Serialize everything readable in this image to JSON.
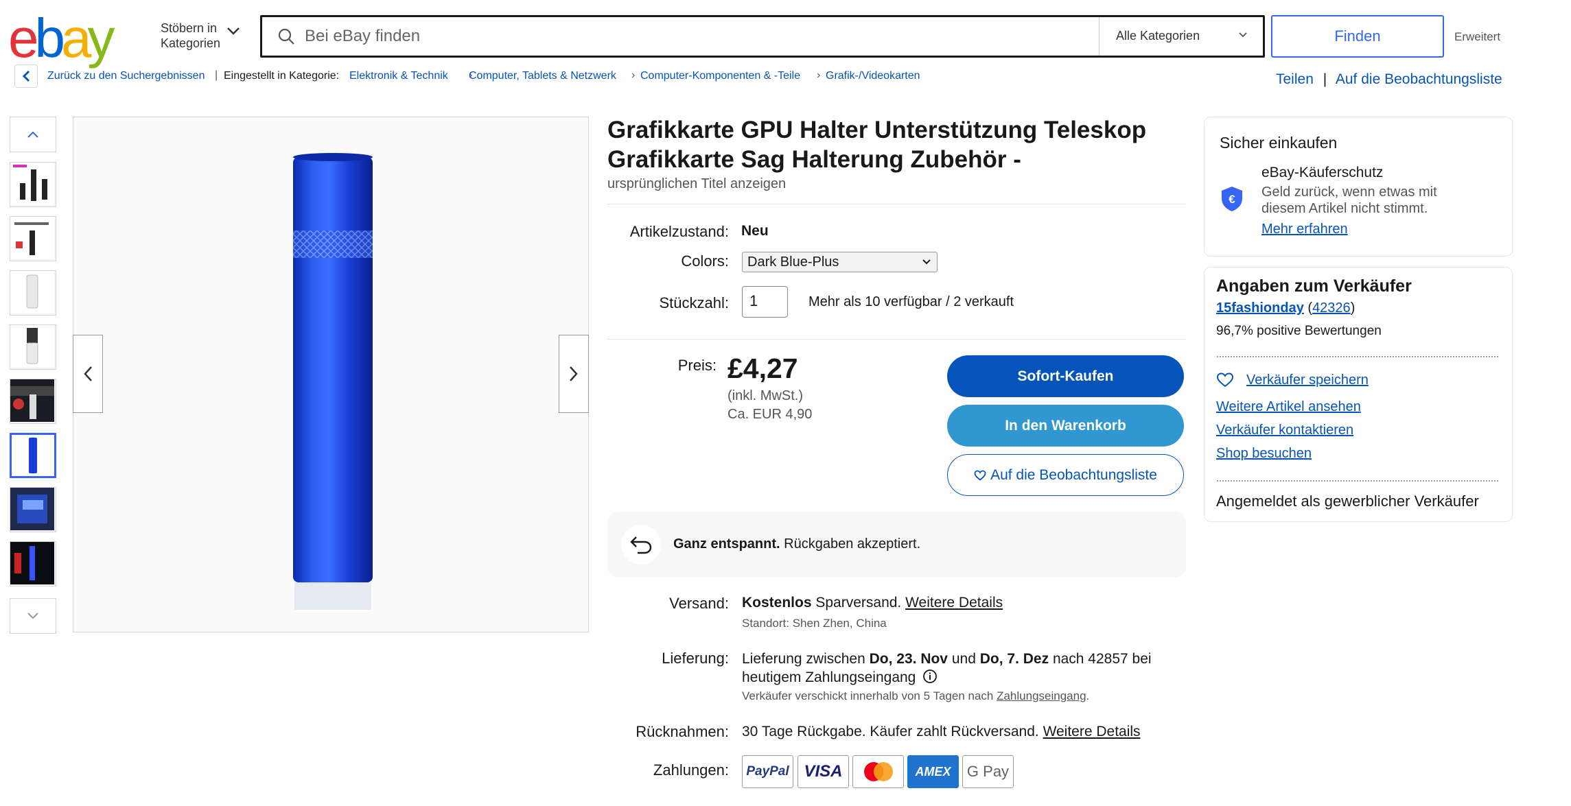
{
  "header": {
    "browse_line1": "Stöbern in",
    "browse_line2": "Kategorien",
    "search_placeholder": "Bei eBay finden",
    "category": "Alle Kategorien",
    "find_label": "Finden",
    "advanced_label": "Erweitert"
  },
  "breadcrumb": {
    "back": "Zurück zu den Suchergebnissen",
    "listed_in": "Eingestellt in Kategorie:",
    "items": [
      "Elektronik & Technik",
      "Computer, Tablets & Netzwerk",
      "Computer-Komponenten & -Teile",
      "Grafik-/Videokarten"
    ],
    "share": "Teilen",
    "watchlist": "Auf die Beobachtungsliste"
  },
  "listing": {
    "title": "Grafikkarte GPU Halter Unterstützung Teleskop Grafikkarte Sag Halterung Zubehör -",
    "original_title": "ursprünglichen Titel anzeigen",
    "condition_label": "Artikelzustand:",
    "condition_value": "Neu",
    "colors_label": "Colors:",
    "colors_value": "Dark Blue-Plus",
    "qty_label": "Stückzahl:",
    "qty_value": "1",
    "availability": "Mehr als 10 verfügbar / 2 verkauft",
    "price_label": "Preis:",
    "price": "£4,27",
    "price_tax": "(inkl. MwSt.)",
    "price_eur": "Ca. EUR 4,90",
    "buy_now": "Sofort-Kaufen",
    "add_cart": "In den Warenkorb",
    "add_watch": "Auf die Beobachtungsliste"
  },
  "returns_banner": {
    "bold": "Ganz entspannt.",
    "text": "Rückgaben akzeptiert."
  },
  "shipping": {
    "label": "Versand:",
    "bold": "Kostenlos",
    "text": "Sparversand.",
    "link": "Weitere Details",
    "location": "Standort: Shen Zhen, China"
  },
  "delivery": {
    "label": "Lieferung:",
    "t1": "Lieferung zwischen",
    "d1": "Do, 23. Nov",
    "t2": "und",
    "d2": "Do, 7. Dez",
    "t3": "nach 42857 bei",
    "line2": "heutigem Zahlungseingang",
    "note": "Verkäufer verschickt innerhalb von 5 Tagen nach",
    "note_link": "Zahlungseingang",
    "note_end": "."
  },
  "returns": {
    "label": "Rücknahmen:",
    "text": "30 Tage Rückgabe. Käufer zahlt Rückversand.",
    "link": "Weitere Details"
  },
  "payments": {
    "label": "Zahlungen:",
    "methods": [
      "PayPal",
      "VISA",
      "Mastercard",
      "AMEX",
      "G Pay"
    ]
  },
  "safe_shopping": {
    "title": "Sicher einkaufen",
    "protection": "eBay-Käuferschutz",
    "desc1": "Geld zurück, wenn etwas mit",
    "desc2": "diesem Artikel nicht stimmt.",
    "link": "Mehr erfahren"
  },
  "seller": {
    "title": "Angaben zum Verkäufer",
    "name": "15fashionday",
    "score": "42326",
    "positive": "96,7% positive Bewertungen",
    "save": "Verkäufer speichern",
    "more_items": "Weitere Artikel ansehen",
    "contact": "Verkäufer kontaktieren",
    "shop": "Shop besuchen",
    "business": "Angemeldet als gewerblicher Verkäufer"
  },
  "colors": {
    "ebay_red": "#e53238",
    "ebay_blue": "#0064d2",
    "ebay_yellow": "#f5af02",
    "ebay_green": "#86b817",
    "link": "#0654ba",
    "buy": "#0654ba",
    "cart": "#3097d1"
  }
}
